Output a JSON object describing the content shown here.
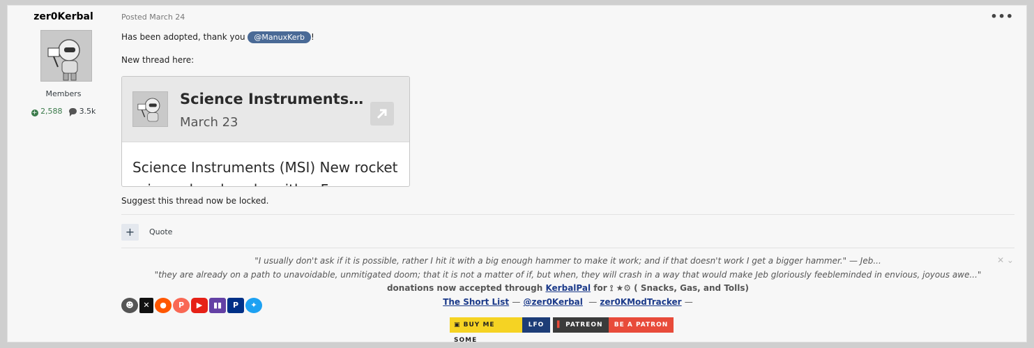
{
  "author": {
    "name": "zer0Kerbal",
    "group": "Members",
    "reputation": "2,588",
    "posts": "3.5k"
  },
  "post": {
    "meta": "Posted March 24",
    "more_icon": "ellipsis-icon",
    "line1_prefix": "Has been adopted, thank you",
    "mention": "@ManuxKerb",
    "line1_suffix": "!",
    "line2": "New thread here:",
    "embed": {
      "title": "Science Instruments (MSI) New rocket",
      "date": "March 23",
      "excerpt": "Science Instruments (MSI) New rocket science head packs with a Fe..."
    },
    "line3": "Suggest this thread now be locked."
  },
  "actions": {
    "plus_label": "+",
    "quote_label": "Quote"
  },
  "signature": {
    "close_label": "✕ ⌄",
    "quote1": "\"I usually don't ask if it is possible, rather I hit it with a big enough hammer to make it work; and if that doesn't work I get a bigger hammer.\"  — Jeb...",
    "quote2": "\"they are already on a path to unavoidable, unmitigated doom; that it is not a matter of if, but when, they will crash in a way that would make Jeb gloriously feebleminded in envious, joyous awe...\"",
    "donations_prefix": "donations now accepted through",
    "donations_link": "KerbalPal",
    "donations_suffix": "for  ⟟ ★⚙  ( Snacks, Gas, and Tolls)",
    "link_shortlist": "The Short List",
    "link_twitter": "@zer0Kerbal",
    "link_tracker": "zer0KModTracker",
    "sep": "—",
    "bmc_label": "BUY ME SOME",
    "bmc_label2": "LFO",
    "patreon_label": "PATREON",
    "patreon_label2": "BE A PATRON"
  },
  "colors": {
    "mention_bg": "#4a6a96",
    "bmc_yellow": "#f5d323",
    "patreon_red": "#e84b3a"
  }
}
